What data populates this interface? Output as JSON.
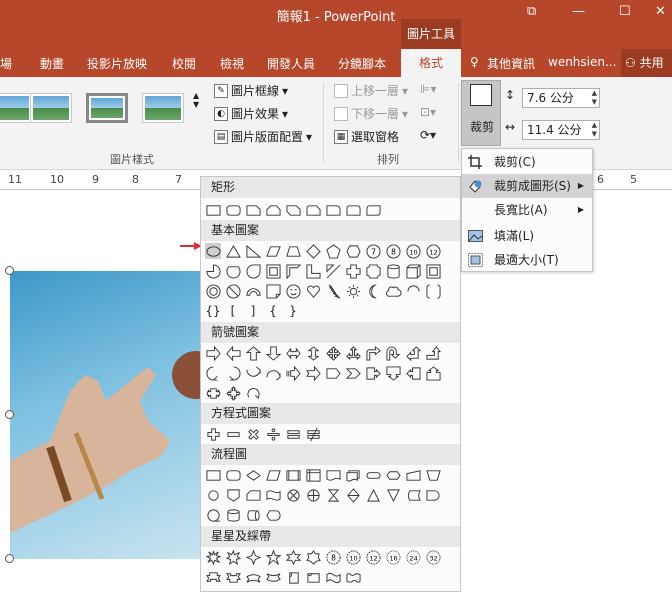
{
  "titlebar": {
    "title": "簡報1 - PowerPoint",
    "tools_label": "圖片工具",
    "restore_icon": "⧉",
    "minimize": "—",
    "maximize": "☐",
    "close": "✕"
  },
  "tabs": [
    {
      "label": "場"
    },
    {
      "label": "動畫"
    },
    {
      "label": "投影片放映"
    },
    {
      "label": "校閱"
    },
    {
      "label": "檢視"
    },
    {
      "label": "開發人員"
    },
    {
      "label": "分鏡腳本"
    }
  ],
  "format_tab": "格式",
  "right_tabs": {
    "tell": "其他資訊",
    "user": "wenhsien...",
    "share": "共用"
  },
  "ribbon": {
    "picture_styles": {
      "label": "圖片樣式",
      "border": "圖片框線",
      "effects": "圖片效果",
      "layout": "圖片版面配置"
    },
    "arrange": {
      "label": "排列",
      "bring_forward": "上移一層",
      "send_backward": "下移一層",
      "selection_pane": "選取窗格"
    },
    "crop": {
      "label": "裁剪"
    },
    "size": {
      "height": "7.6 公分",
      "width": "11.4 公分"
    }
  },
  "ruler": [
    "11",
    "10",
    "9",
    "8",
    "7",
    "6",
    "5",
    "6"
  ],
  "shapes_panel": {
    "sections": [
      {
        "name": "矩形"
      },
      {
        "name": "基本圖案"
      },
      {
        "name": "箭號圖案"
      },
      {
        "name": "方程式圖案"
      },
      {
        "name": "流程圖"
      },
      {
        "name": "星星及綵帶"
      }
    ],
    "basic_numbers": [
      "7",
      "8",
      "10",
      "12"
    ],
    "brace_labels": [
      "{}",
      "[",
      "]",
      "{",
      "}"
    ],
    "star_numbers": [
      "8",
      "10",
      "12",
      "16",
      "24",
      "32"
    ]
  },
  "crop_menu": [
    {
      "label": "裁剪(C)",
      "icon": "crop-icon"
    },
    {
      "label": "裁剪成圖形(S)",
      "icon": "shape-icon",
      "submenu": true,
      "highlight": true
    },
    {
      "label": "長寬比(A)",
      "icon": "",
      "submenu": true
    },
    {
      "label": "填滿(L)",
      "icon": "fill-icon"
    },
    {
      "label": "最適大小(T)",
      "icon": "fit-icon"
    }
  ]
}
